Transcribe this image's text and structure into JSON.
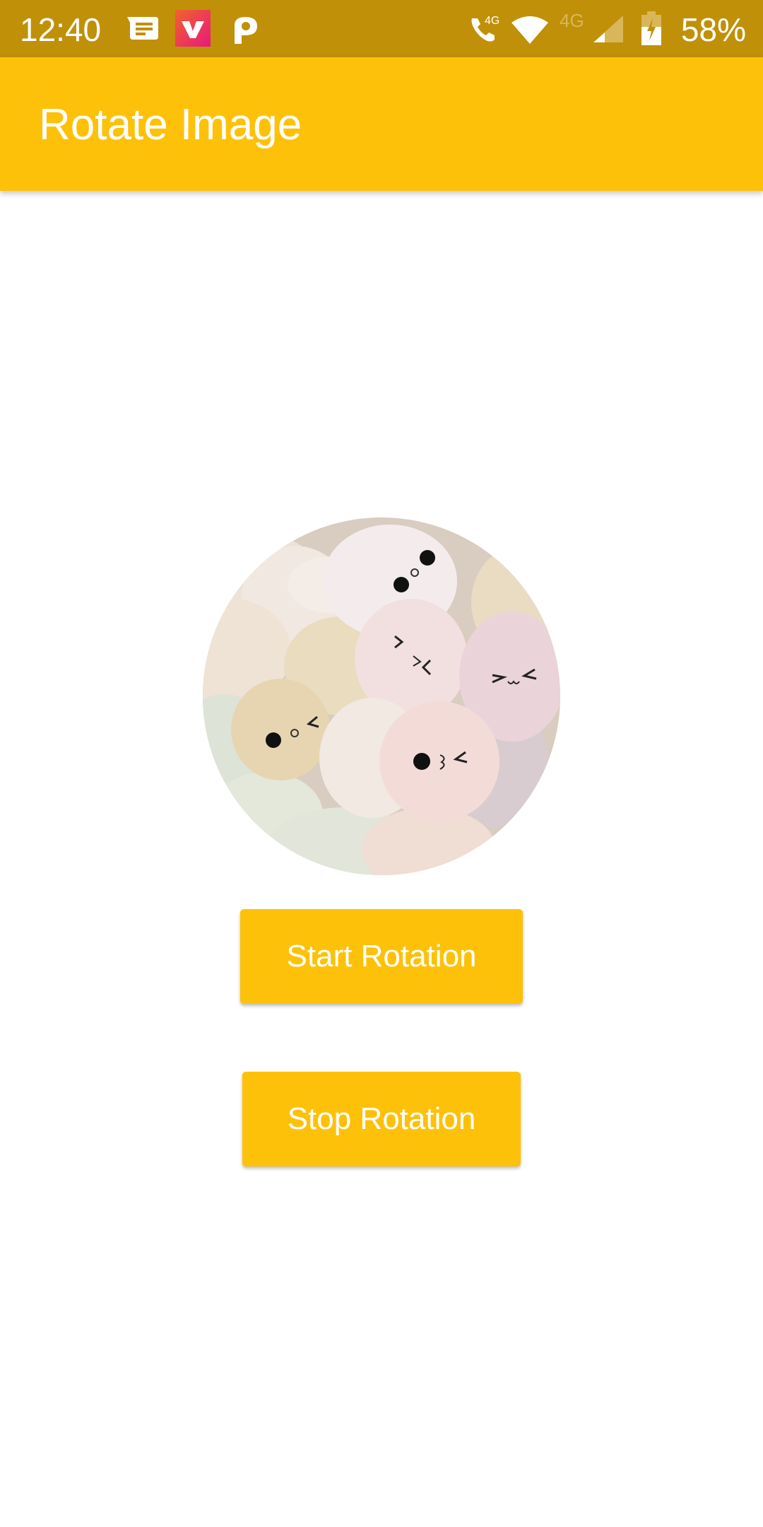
{
  "status_bar": {
    "time": "12:40",
    "battery_percent": "58%",
    "left_icons": [
      "message-notification-icon",
      "vidmate-app-icon",
      "p-app-icon"
    ],
    "right_icons": [
      "volte-call-4g-icon",
      "wifi-icon",
      "mobile-4g-signal-icon",
      "battery-charging-icon"
    ],
    "volte_label": "4G",
    "network_label": "4G"
  },
  "app_bar": {
    "title": "Rotate Image",
    "color": "#fec10a"
  },
  "main": {
    "image_description": "Circular photo of pastel egg-shaped pebbles with cute faces",
    "buttons": {
      "start_label": "Start Rotation",
      "stop_label": "Stop Rotation"
    }
  },
  "colors": {
    "status_bar": "#c09008",
    "accent": "#fec10a",
    "button_text": "#ffffff",
    "background": "#ffffff"
  }
}
